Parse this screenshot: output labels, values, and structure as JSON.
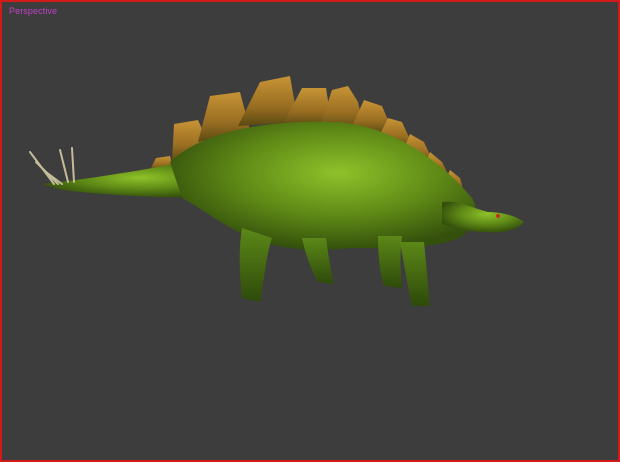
{
  "viewport": {
    "label": "Perspective",
    "background_color": "#3d3d3d",
    "border_color": "#d11a1a",
    "label_color": "#c040c8"
  },
  "model": {
    "body_color": "#6c9a1c",
    "plate_color": "#b8862c",
    "spike_color": "#b8b090"
  }
}
